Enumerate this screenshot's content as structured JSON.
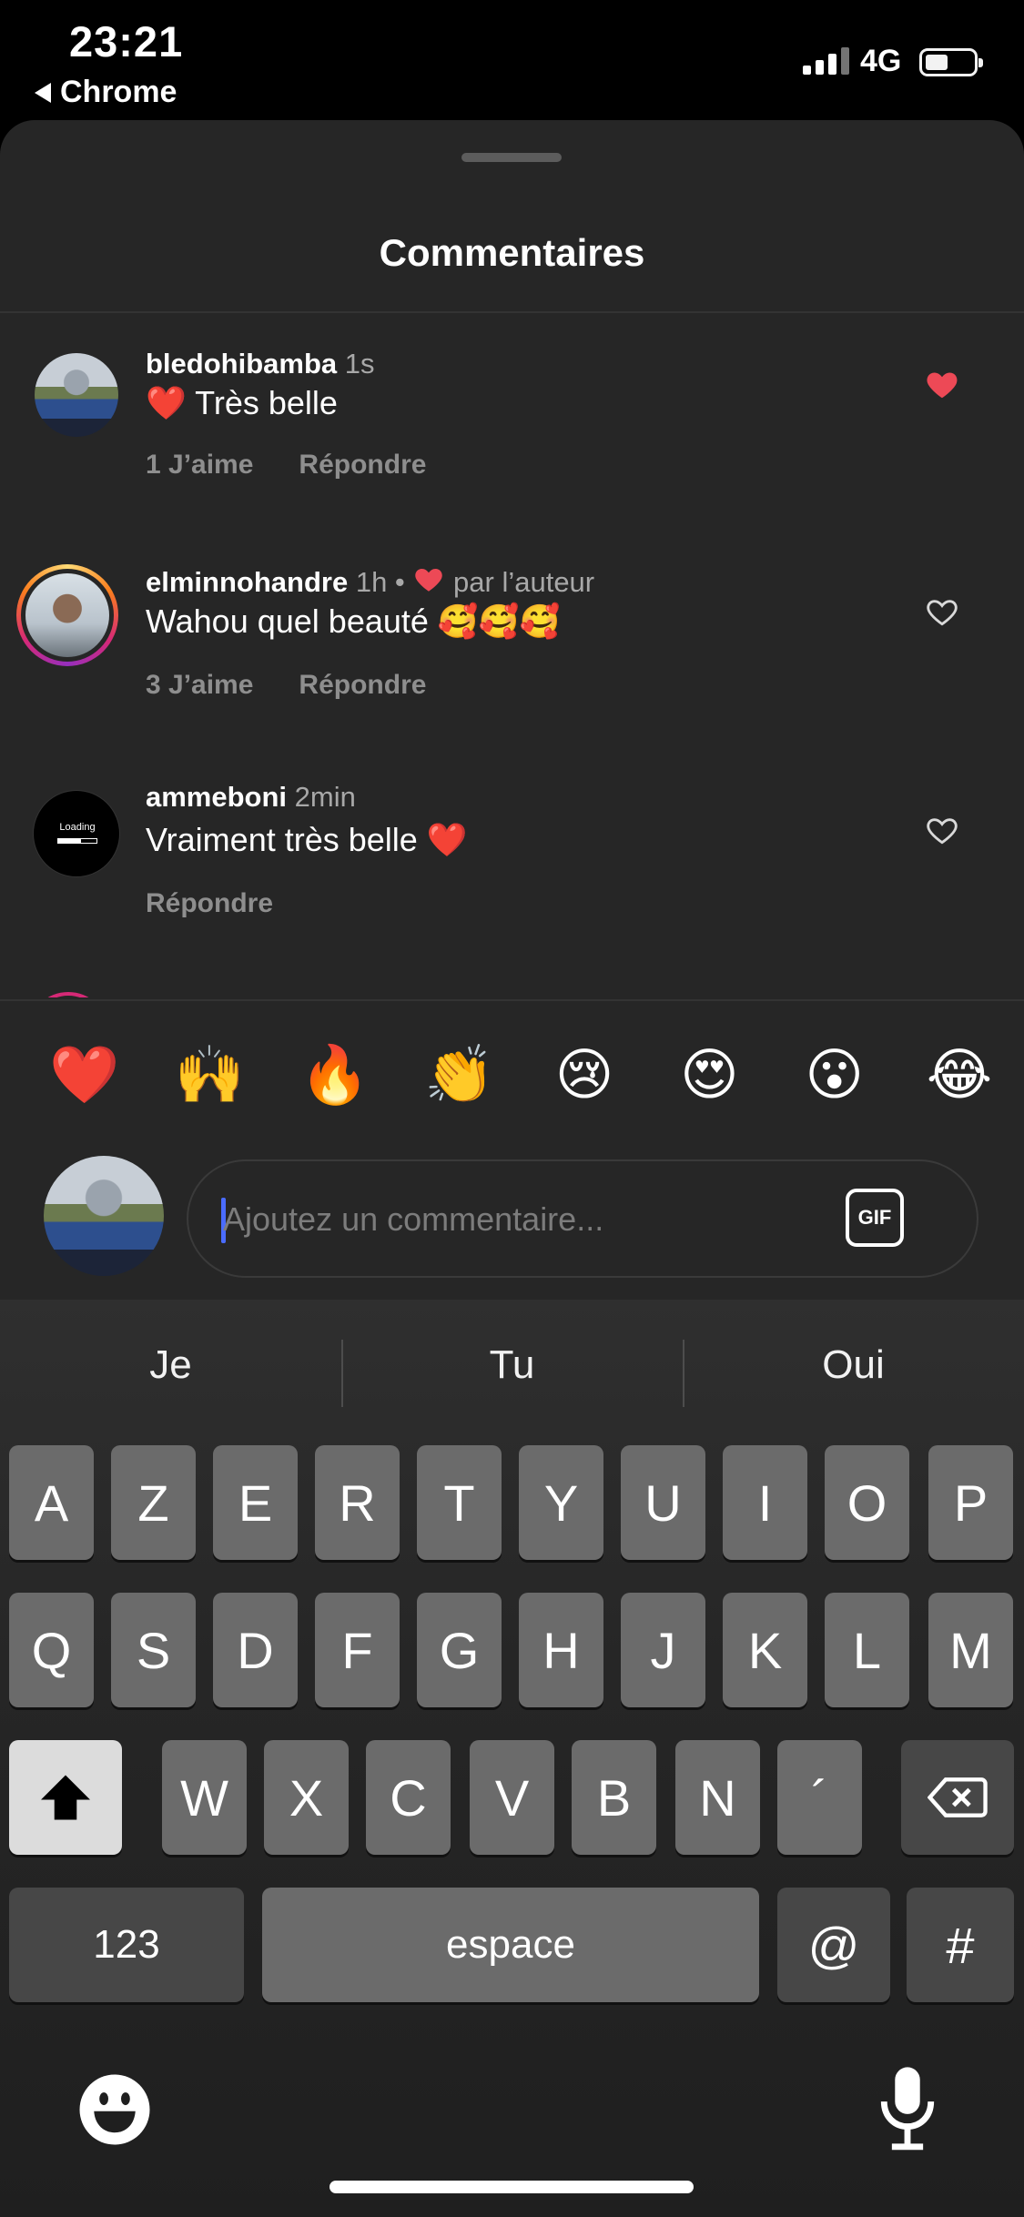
{
  "status": {
    "time": "23:21",
    "back_app": "Chrome",
    "network": "4G"
  },
  "sheet": {
    "title": "Commentaires"
  },
  "comments": [
    {
      "username": "bledohibamba",
      "meta": "1s",
      "text": "❤️ Très belle",
      "likes": "1 J’aime",
      "reply": "Répondre",
      "liked": true
    },
    {
      "username": "elminnohandre",
      "meta": "1h •",
      "author_like": "par l’auteur",
      "text": "Wahou quel beauté 🥰🥰🥰",
      "likes": "3 J’aime",
      "reply": "Répondre",
      "liked": false
    },
    {
      "username": "ammeboni",
      "meta": "2min",
      "text": "Vraiment très belle ❤️",
      "reply": "Répondre",
      "liked": false,
      "avatar_text": "Loading"
    }
  ],
  "emoji_bar": [
    "❤️",
    "🙌",
    "🔥",
    "👏",
    "😢",
    "😍",
    "😮",
    "😂"
  ],
  "input": {
    "placeholder": "Ajoutez un commentaire...",
    "gif_label": "GIF"
  },
  "keyboard": {
    "suggestions": [
      "Je",
      "Tu",
      "Oui"
    ],
    "row1": [
      "A",
      "Z",
      "E",
      "R",
      "T",
      "Y",
      "U",
      "I",
      "O",
      "P"
    ],
    "row2": [
      "Q",
      "S",
      "D",
      "F",
      "G",
      "H",
      "J",
      "K",
      "L",
      "M"
    ],
    "row3": [
      "W",
      "X",
      "C",
      "V",
      "B",
      "N",
      "´"
    ],
    "numbers_label": "123",
    "space_label": "espace",
    "at_label": "@",
    "hash_label": "#"
  },
  "icons": {
    "liked": "heart-filled-icon",
    "unliked": "heart-outline-icon",
    "emoji": "emoji-icon",
    "mic": "microphone-icon",
    "shift": "shift-icon",
    "backspace": "backspace-icon"
  },
  "colors": {
    "accent_red": "#ed4956",
    "background": "#262626",
    "caret": "#4a6cff"
  }
}
